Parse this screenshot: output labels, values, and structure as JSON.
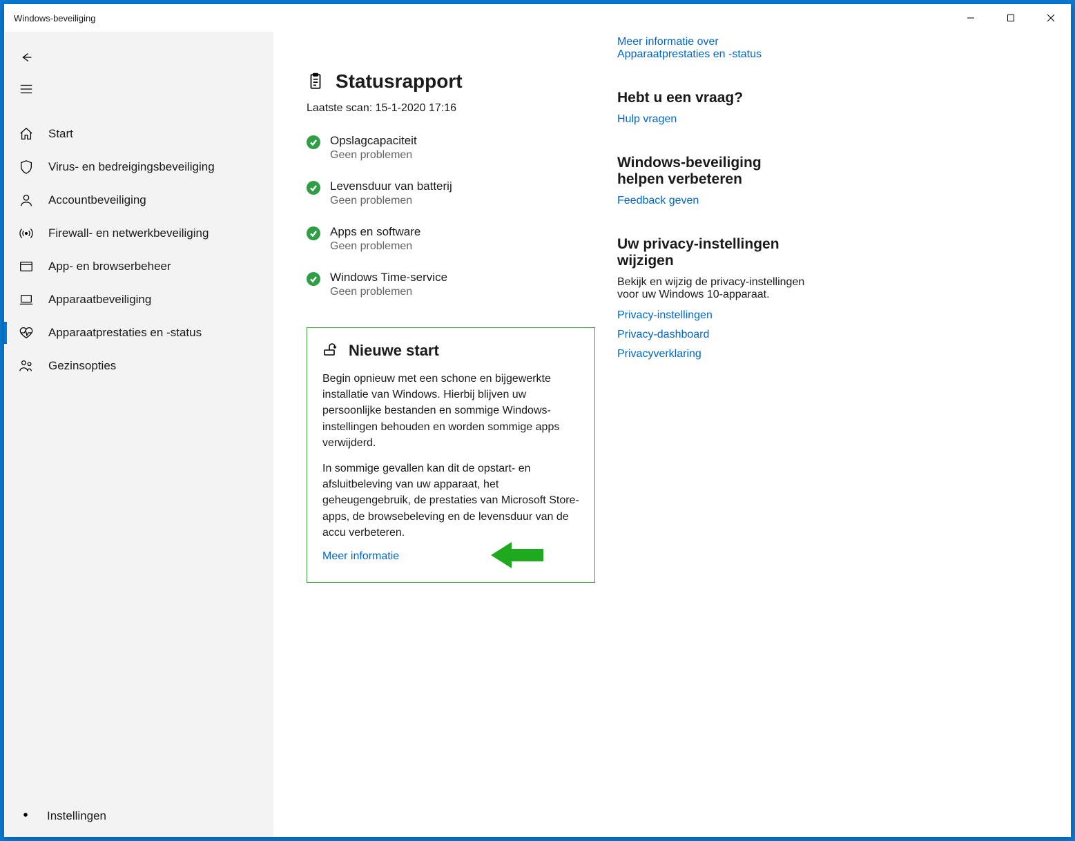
{
  "window": {
    "title": "Windows-beveiliging"
  },
  "sidebar": {
    "items": [
      {
        "key": "home",
        "label": "Start",
        "icon": "home"
      },
      {
        "key": "virus",
        "label": "Virus- en bedreigingsbeveiliging",
        "icon": "shield"
      },
      {
        "key": "account",
        "label": "Accountbeveiliging",
        "icon": "person"
      },
      {
        "key": "firewall",
        "label": "Firewall- en netwerkbeveiliging",
        "icon": "antenna"
      },
      {
        "key": "app",
        "label": "App- en browserbeheer",
        "icon": "app"
      },
      {
        "key": "device",
        "label": "Apparaatbeveiliging",
        "icon": "laptop"
      },
      {
        "key": "health",
        "label": "Apparaatprestaties en -status",
        "icon": "heart",
        "active": true
      },
      {
        "key": "family",
        "label": "Gezinsopties",
        "icon": "family"
      }
    ],
    "settings_label": "Instellingen"
  },
  "main": {
    "status_heading": "Statusrapport",
    "scan_label": "Laatste scan:",
    "scan_value": "15-1-2020 17:16",
    "items": [
      {
        "title": "Opslagcapaciteit",
        "sub": "Geen problemen"
      },
      {
        "title": "Levensduur van batterij",
        "sub": "Geen problemen"
      },
      {
        "title": "Apps en software",
        "sub": "Geen problemen"
      },
      {
        "title": "Windows Time-service",
        "sub": "Geen problemen"
      }
    ],
    "fresh_start": {
      "heading": "Nieuwe start",
      "p1": "Begin opnieuw met een schone en bijgewerkte installatie van Windows. Hierbij blijven uw persoonlijke bestanden en sommige Windows-instellingen behouden en worden sommige apps verwijderd.",
      "p2": "In sommige gevallen kan dit de opstart- en afsluitbeleving van uw apparaat, het geheugengebruik, de prestaties van Microsoft Store-apps, de browsebeleving en de levensduur van de accu verbeteren.",
      "link": "Meer informatie"
    }
  },
  "side": {
    "top_link": "Meer informatie over Apparaatprestaties en -status",
    "help": {
      "heading": "Hebt u een vraag?",
      "link": "Hulp vragen"
    },
    "feedback": {
      "heading": "Windows-beveiliging helpen verbeteren",
      "link": "Feedback geven"
    },
    "privacy": {
      "heading": "Uw privacy-instellingen wijzigen",
      "desc": "Bekijk en wijzig de privacy-instellingen voor uw Windows 10-apparaat.",
      "links": [
        "Privacy-instellingen",
        "Privacy-dashboard",
        "Privacyverklaring"
      ]
    }
  }
}
